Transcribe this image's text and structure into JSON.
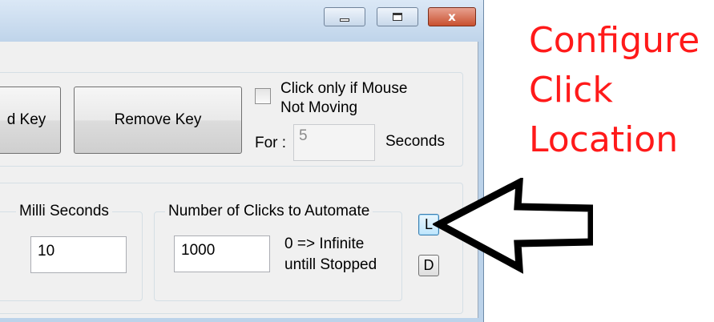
{
  "window": {
    "caption_buttons": [
      {
        "name": "minimize",
        "icon": "minimize-icon"
      },
      {
        "name": "maximize",
        "icon": "maximize-icon"
      },
      {
        "name": "close",
        "icon": "close-icon",
        "glyph": "x"
      }
    ]
  },
  "hotkeys": {
    "add_key_label": "d Key",
    "remove_key_label": "Remove Key",
    "mouse_check_label_line1": "Click only if Mouse",
    "mouse_check_label_line2": "Not Moving",
    "mouse_check_checked": false,
    "for_label": "For :",
    "seconds_value": "5",
    "seconds_label": "Seconds"
  },
  "delay": {
    "legend": "Milli Seconds",
    "value": "10"
  },
  "clicks": {
    "legend": "Number of Clicks to Automate",
    "value": "1000",
    "hint_line1": "0 => Infinite",
    "hint_line2": "untill Stopped"
  },
  "location_buttons": {
    "l_label": "L",
    "d_label": "D"
  },
  "callout": {
    "line1": "Configure",
    "line2": "Click",
    "line3": "Location",
    "color": "#ff1a1a"
  },
  "colors": {
    "title_bar": "#bfd4ea",
    "close_button": "#c9502f",
    "client_background": "#f0f0f0"
  }
}
